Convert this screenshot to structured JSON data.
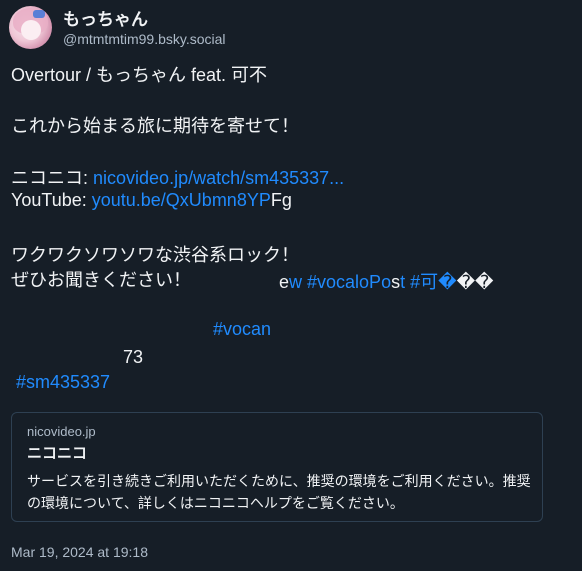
{
  "author": {
    "display_name": "もっちゃん",
    "handle": "@mtmtmtim99.bsky.social"
  },
  "post": {
    "title_line": "Overtour / もっちゃん feat. 可不",
    "line_intro": "これから始まる旅に期待を寄せて！",
    "nico_label": "ニコニコ: ",
    "nico_link": "nicovideo.jp/watch/sm435337...",
    "youtube_label": "YouTube: ",
    "youtube_link": "youtu.be/QxUbmn8YP",
    "youtube_suffix": "Fg",
    "line_rock": "ワクワクソワソワな渋谷系ロック！",
    "line_listen": "ぜひお聞きください！",
    "garbled_e": "e",
    "garbled_w": "w ",
    "tag_vocalopost_a": "#vocaloPo",
    "garbled_s": "s",
    "tag_vocalopost_b": "t",
    "tag_kafu": " #可�",
    "garbled_tail": "��",
    "tag_vocan": "#vocan",
    "number_73": "73",
    "tag_sm": "#sm435337"
  },
  "link_card": {
    "domain": "nicovideo.jp",
    "title": "ニコニコ",
    "description": "サービスを引き続きご利用いただくために、推奨の環境をご利用ください。推奨の環境について、詳しくはニコニコヘルプをご覧ください。"
  },
  "timestamp": "Mar 19, 2024 at 19:18",
  "colors": {
    "background": "#161e27",
    "text": "#f1f3f5",
    "muted": "#aebbc9",
    "link": "#208bfe",
    "card_border": "#2e4052"
  }
}
